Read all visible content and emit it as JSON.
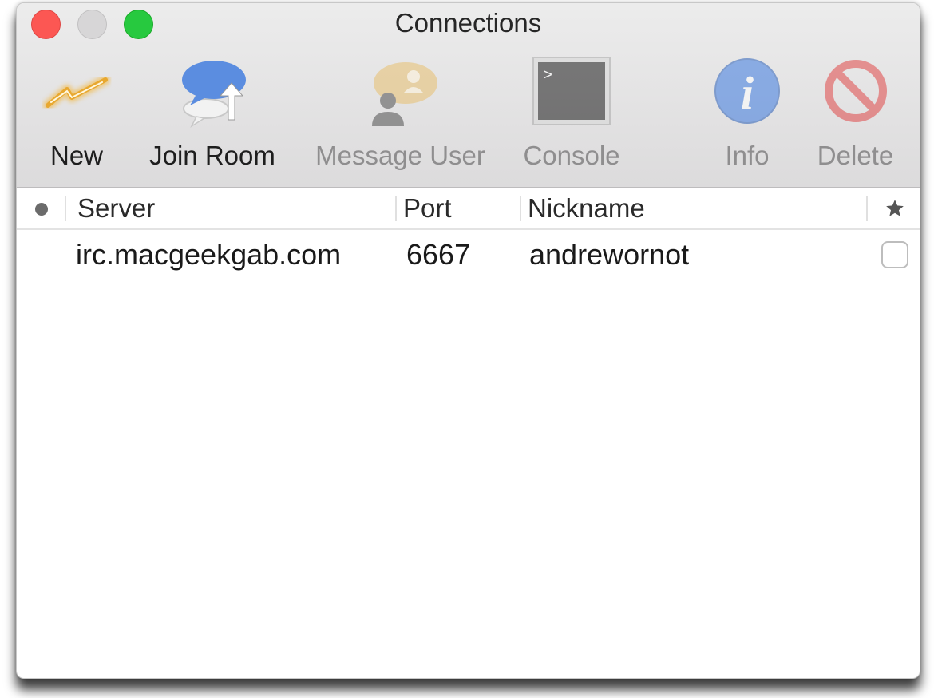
{
  "window": {
    "title": "Connections"
  },
  "toolbar": {
    "items": [
      {
        "id": "new",
        "label": "New",
        "icon": "lightning-icon",
        "enabled": true
      },
      {
        "id": "join-room",
        "label": "Join Room",
        "icon": "chat-bubble-arrow-icon",
        "enabled": true
      },
      {
        "id": "message-user",
        "label": "Message User",
        "icon": "user-message-icon",
        "enabled": false
      },
      {
        "id": "console",
        "label": "Console",
        "icon": "terminal-icon",
        "enabled": false
      },
      {
        "id": "info",
        "label": "Info",
        "icon": "info-icon",
        "enabled": false
      },
      {
        "id": "delete",
        "label": "Delete",
        "icon": "delete-icon",
        "enabled": false
      }
    ],
    "console_prompt": ">_",
    "info_glyph": "i"
  },
  "table": {
    "columns": [
      {
        "id": "status",
        "label": "",
        "icon": "status-dot-icon"
      },
      {
        "id": "server",
        "label": "Server"
      },
      {
        "id": "port",
        "label": "Port"
      },
      {
        "id": "nickname",
        "label": "Nickname"
      },
      {
        "id": "favorite",
        "label": "",
        "icon": "star-icon"
      }
    ],
    "rows": [
      {
        "server": "irc.macgeekgab.com",
        "port": "6667",
        "nickname": "andrewornot",
        "favorite": false
      }
    ]
  }
}
